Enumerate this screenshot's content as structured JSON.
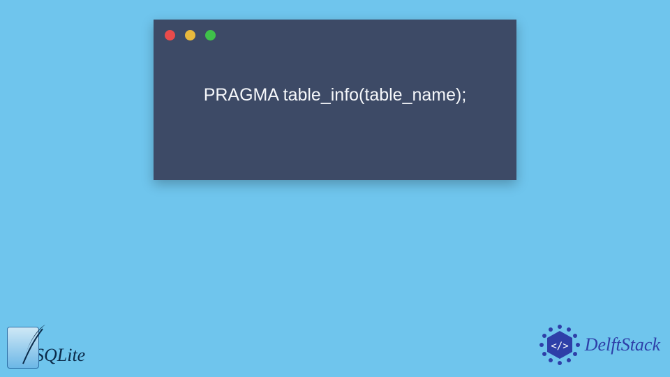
{
  "code_window": {
    "traffic_lights": [
      "red",
      "yellow",
      "green"
    ],
    "code_line": "PRAGMA table_info(table_name);"
  },
  "logos": {
    "sqlite_label": "SQLite",
    "delftstack_label": "DelftStack"
  },
  "colors": {
    "background": "#6fc5ed",
    "window_bg": "#3d4a66",
    "code_text": "#f5f7fa",
    "delft_blue": "#2e3fa8",
    "sqlite_text": "#0b2b4a"
  }
}
